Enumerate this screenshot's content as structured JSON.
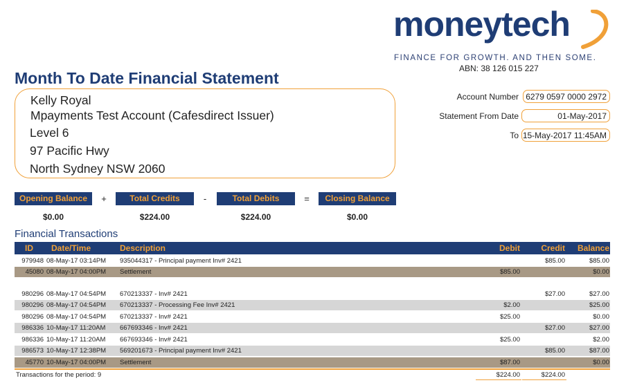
{
  "brand": {
    "name": "moneytech",
    "tagline": "FINANCE FOR GROWTH. AND THEN SOME.",
    "abn": "ABN: 38 126 015 227",
    "colors": {
      "navy": "#1f3d75",
      "orange": "#f0a038"
    }
  },
  "title": "Month To Date Financial Statement",
  "address": {
    "name": "Kelly Royal",
    "account_name": "Mpayments Test Account (Cafesdirect Issuer)",
    "line1": "Level 6",
    "line2": "97 Pacific Hwy",
    "line3": "North Sydney NSW 2060"
  },
  "account": {
    "number_label": "Account Number",
    "number": "6279 0597 0000 2972",
    "from_label": "Statement From Date",
    "from": "01-May-2017",
    "to_label": "To",
    "to": "15-May-2017 11:45AM"
  },
  "summary": {
    "opening_label": "Opening Balance",
    "opening_value": "$0.00",
    "plus": "+",
    "credits_label": "Total Credits",
    "credits_value": "$224.00",
    "minus": "-",
    "debits_label": "Total Debits",
    "debits_value": "$224.00",
    "equals": "=",
    "closing_label": "Closing Balance",
    "closing_value": "$0.00"
  },
  "transactions": {
    "title": "Financial Transactions",
    "headers": {
      "id": "ID",
      "datetime": "Date/Time",
      "description": "Description",
      "debit": "Debit",
      "credit": "Credit",
      "balance": "Balance"
    },
    "rows": [
      {
        "id": "979948",
        "datetime": "08-May-17 03:14PM",
        "description": "935044317 - Principal payment Inv# 2421",
        "debit": "",
        "credit": "$85.00",
        "balance": "$85.00",
        "style": "white"
      },
      {
        "id": "45080",
        "datetime": "08-May-17 04:00PM",
        "description": "Settlement",
        "debit": "$85.00",
        "credit": "",
        "balance": "$0.00",
        "style": "brown"
      },
      {
        "id": "980296",
        "datetime": "08-May-17 04:54PM",
        "description": "670213337 - Inv# 2421",
        "debit": "",
        "credit": "$27.00",
        "balance": "$27.00",
        "style": "white"
      },
      {
        "id": "980296",
        "datetime": "08-May-17 04:54PM",
        "description": "670213337 - Processing Fee Inv# 2421",
        "debit": "$2.00",
        "credit": "",
        "balance": "$25.00",
        "style": "gray"
      },
      {
        "id": "980296",
        "datetime": "08-May-17 04:54PM",
        "description": "670213337 - Inv# 2421",
        "debit": "$25.00",
        "credit": "",
        "balance": "$0.00",
        "style": "white"
      },
      {
        "id": "986336",
        "datetime": "10-May-17 11:20AM",
        "description": "667693346 - Inv# 2421",
        "debit": "",
        "credit": "$27.00",
        "balance": "$27.00",
        "style": "gray"
      },
      {
        "id": "986336",
        "datetime": "10-May-17 11:20AM",
        "description": "667693346 - Inv# 2421",
        "debit": "$25.00",
        "credit": "",
        "balance": "$2.00",
        "style": "white"
      },
      {
        "id": "986573",
        "datetime": "10-May-17 12:38PM",
        "description": "569201673 - Principal payment Inv# 2421",
        "debit": "",
        "credit": "$85.00",
        "balance": "$87.00",
        "style": "gray"
      },
      {
        "id": "45770",
        "datetime": "10-May-17 04:00PM",
        "description": "Settlement",
        "debit": "$87.00",
        "credit": "",
        "balance": "$0.00",
        "style": "brown"
      }
    ],
    "footer": {
      "count_label": "Transactions for the period: 9",
      "total_debit": "$224.00",
      "total_credit": "$224.00"
    }
  }
}
